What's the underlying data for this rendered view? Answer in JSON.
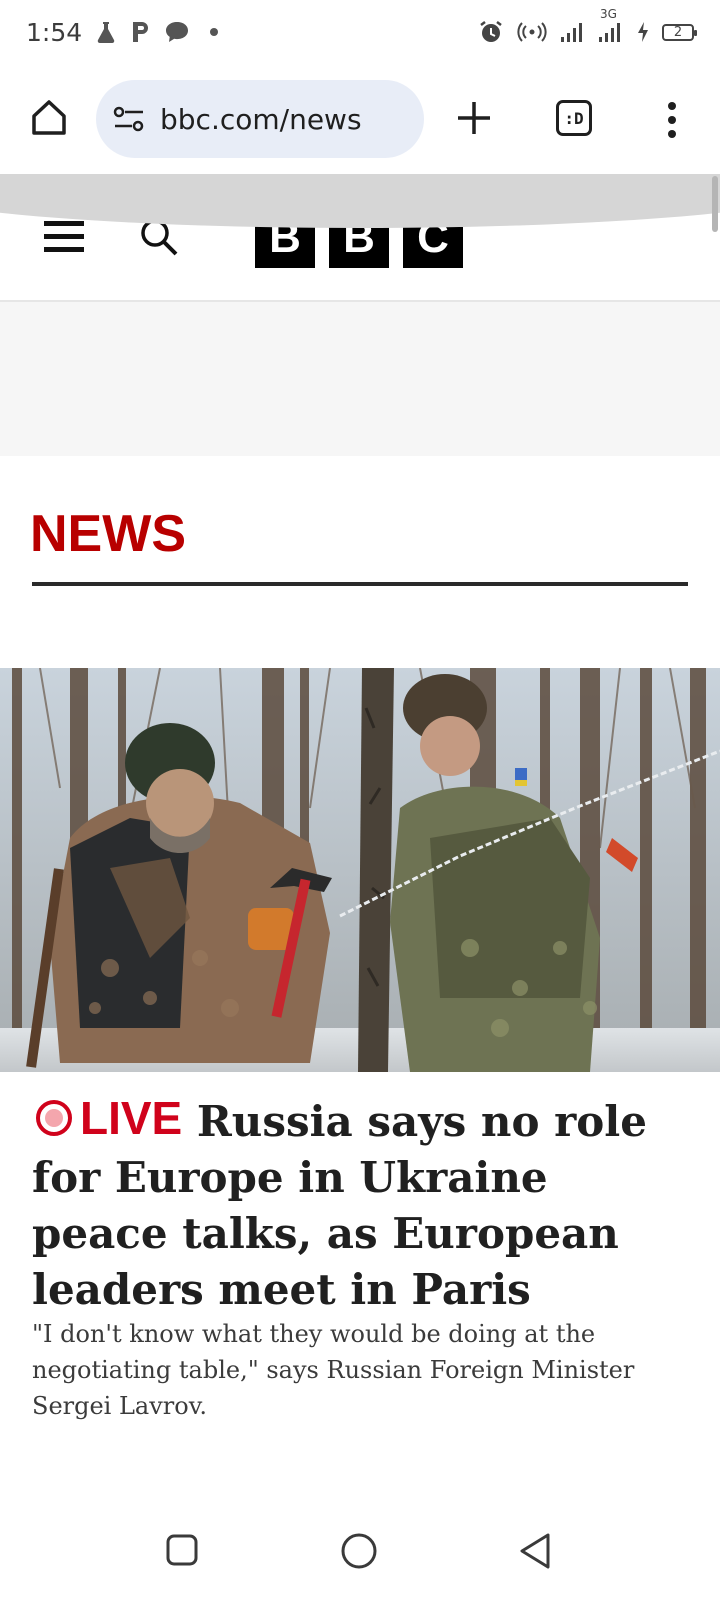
{
  "status_bar": {
    "time": "1:54",
    "network_label": "3G",
    "battery_level": "2"
  },
  "browser": {
    "url": "bbc.com/news",
    "tabs_label": ":D"
  },
  "site": {
    "logo_letters": [
      "B",
      "B",
      "C"
    ],
    "section_title": "NEWS"
  },
  "article": {
    "live_label": "LIVE",
    "headline": "Russia says no role for Europe in Ukraine peace talks, as European leaders meet in Paris",
    "summary": "\"I don't know what they would be doing at the negotiating table,\" says Russian Foreign Minister Sergei Lavrov."
  },
  "colors": {
    "bbc_news_red": "#b80000",
    "live_red": "#d0021b",
    "omnibox_bg": "#e8edf7",
    "ad_placeholder_bg": "#f6f6f6"
  },
  "icons": {
    "status_left": [
      "flask-icon",
      "p-app-icon",
      "chat-bubble-icon",
      "notification-dot-icon"
    ],
    "status_right": [
      "alarm-icon",
      "hotspot-icon",
      "signal-icon",
      "signal-3g-icon",
      "charging-icon",
      "battery-icon"
    ],
    "toolbar": [
      "home-icon",
      "site-settings-icon",
      "new-tab-icon",
      "tab-switcher-icon",
      "more-menu-icon"
    ],
    "site_header": [
      "hamburger-menu-icon",
      "search-icon"
    ],
    "system_nav": [
      "recents-icon",
      "home-circle-icon",
      "back-triangle-icon"
    ]
  }
}
